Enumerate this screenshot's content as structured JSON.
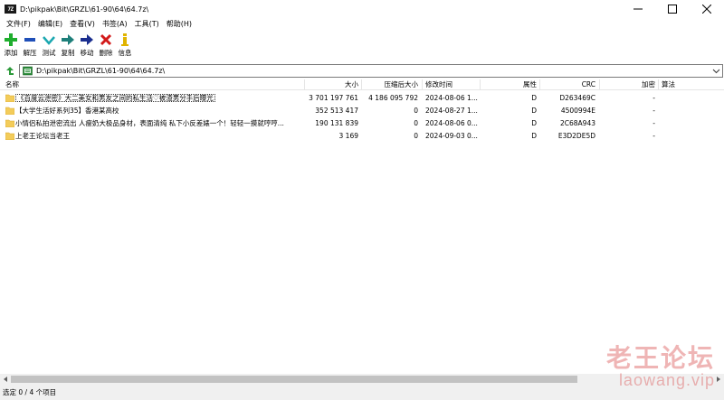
{
  "window": {
    "app_icon_text": "7Z",
    "title": "D:\\pikpak\\Bit\\GRZL\\61-90\\64\\64.7z\\"
  },
  "menu": [
    {
      "id": "file",
      "label": "文件(F)"
    },
    {
      "id": "edit",
      "label": "编辑(E)"
    },
    {
      "id": "view",
      "label": "查看(V)"
    },
    {
      "id": "favorites",
      "label": "书签(A)"
    },
    {
      "id": "tools",
      "label": "工具(T)"
    },
    {
      "id": "help",
      "label": "帮助(H)"
    }
  ],
  "toolbar": [
    {
      "id": "add",
      "label": "添加",
      "icon": "plus-icon",
      "color": "#1fae2e"
    },
    {
      "id": "extract",
      "label": "解压",
      "icon": "minus-icon",
      "color": "#1f4fb8"
    },
    {
      "id": "test",
      "label": "测试",
      "icon": "check-icon",
      "color": "#1aa7b0"
    },
    {
      "id": "copy",
      "label": "复制",
      "icon": "arrow-right-icon",
      "color": "#1e7f7a"
    },
    {
      "id": "move",
      "label": "移动",
      "icon": "arrow-right-icon",
      "color": "#1b2f8f"
    },
    {
      "id": "delete",
      "label": "删除",
      "icon": "x-icon",
      "color": "#d21a1a"
    },
    {
      "id": "info",
      "label": "信息",
      "icon": "info-icon",
      "color": "#e0b400"
    }
  ],
  "address": {
    "path": "D:\\pikpak\\Bit\\GRZL\\61-90\\64\\64.7z\\"
  },
  "columns": {
    "name": "名称",
    "size": "大小",
    "packed": "压缩后大小",
    "modified": "修改时间",
    "attributes": "属性",
    "crc": "CRC",
    "encrypted": "加密",
    "method": "算法"
  },
  "files": [
    {
      "name": "《百度云泄密》大二美女和男友之间的私生活♡被渣男分手后曝光",
      "size": "3 701 197 761",
      "packed": "4 186 095 792",
      "modified": "2024-08-06 1...",
      "attributes": "D",
      "crc": "D263469C",
      "encrypted": "-"
    },
    {
      "name": "【大学生活好系列35】香港某高校",
      "size": "352 513 417",
      "packed": "0",
      "modified": "2024-08-27 1...",
      "attributes": "D",
      "crc": "4500994E",
      "encrypted": "-"
    },
    {
      "name": "小情侣私拍泄密流出 人瘦奶大极品身材，表面清纯 私下小反差婊一个！轻轻一摸就哼哼...",
      "size": "190 131 839",
      "packed": "0",
      "modified": "2024-08-06 0...",
      "attributes": "D",
      "crc": "2C68A943",
      "encrypted": "-"
    },
    {
      "name": "上老王论坛当老王",
      "size": "3 169",
      "packed": "0",
      "modified": "2024-09-03 0...",
      "attributes": "D",
      "crc": "E3D2DE5D",
      "encrypted": "-"
    }
  ],
  "status": {
    "selection": "选定 0 / 4 个项目"
  },
  "watermark": {
    "cn": "老王论坛",
    "en": "laowang.vip"
  },
  "colors": {
    "folder": "#f3cc5a",
    "folder_edge": "#d9a72e"
  }
}
